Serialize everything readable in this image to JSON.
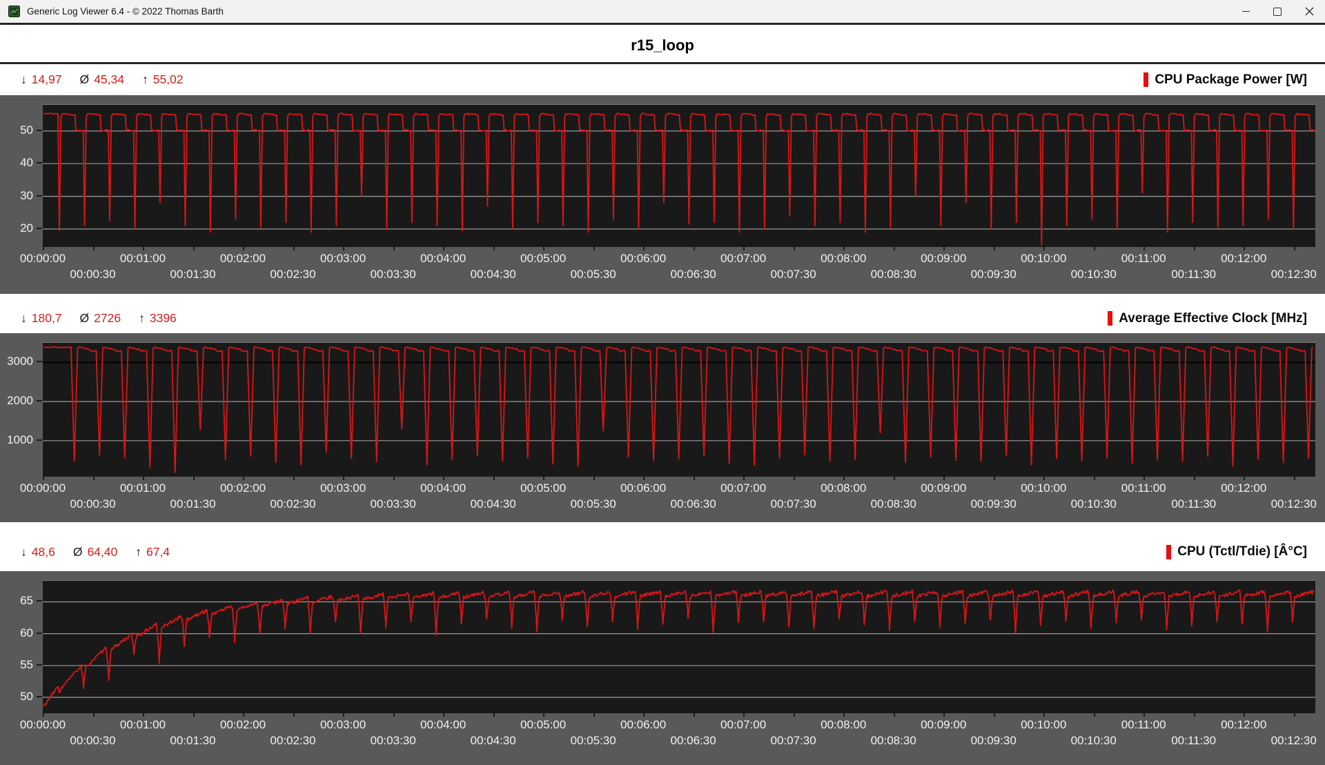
{
  "window": {
    "title": "Generic Log Viewer 6.4 - © 2022 Thomas Barth"
  },
  "header": {
    "title": "r15_loop"
  },
  "charts": [
    {
      "label": "CPU Package Power [W]",
      "accent_color": "#e60e0e",
      "stats": {
        "min_icon": "↓",
        "min": "14,97",
        "avg_icon": "Ø",
        "avg": "45,34",
        "max_icon": "↑",
        "max": "55,02"
      }
    },
    {
      "label": "Average Effective Clock [MHz]",
      "accent_color": "#e60e0e",
      "stats": {
        "min_icon": "↓",
        "min": "180,7",
        "avg_icon": "Ø",
        "avg": "2726",
        "max_icon": "↑",
        "max": "3396"
      }
    },
    {
      "label": "CPU (Tctl/Tdie) [Â°C]",
      "accent_color": "#e60e0e",
      "stats": {
        "min_icon": "↓",
        "min": "48,6",
        "avg_icon": "Ø",
        "avg": "64,40",
        "max_icon": "↑",
        "max": "67,4"
      }
    }
  ],
  "chart_data": [
    {
      "type": "line",
      "title": "CPU Package Power [W]",
      "series_color": "#db1616",
      "grid": true,
      "legend_position": "top-right",
      "stats": {
        "min": 14.97,
        "avg": 45.34,
        "max": 55.02
      },
      "y_axis": {
        "range": [
          14.5,
          58
        ],
        "ticks": [
          20,
          30,
          40,
          50
        ],
        "dark_gridlines": []
      },
      "x_axis": {
        "unit": "time",
        "duration_seconds": 762,
        "tick_labels_row1": [
          "00:00:00",
          "00:01:00",
          "00:02:00",
          "00:03:00",
          "00:04:00",
          "00:05:00",
          "00:06:00",
          "00:07:00",
          "00:08:00",
          "00:09:00",
          "00:10:00",
          "00:11:00",
          "00:12:00"
        ],
        "tick_seconds_row1": [
          0,
          60,
          120,
          180,
          240,
          300,
          360,
          420,
          480,
          540,
          600,
          660,
          720
        ],
        "tick_labels_row2": [
          "00:00:30",
          "00:01:30",
          "00:02:30",
          "00:03:30",
          "00:04:30",
          "00:05:30",
          "00:06:30",
          "00:07:30",
          "00:08:30",
          "00:09:30",
          "00:10:30",
          "00:11:30",
          "00:12:30"
        ],
        "tick_seconds_row2": [
          30,
          90,
          150,
          210,
          270,
          330,
          390,
          450,
          510,
          570,
          630,
          690,
          750
        ]
      },
      "waveform": {
        "kind": "loop-plateau",
        "seed": 11,
        "period": 15.1,
        "first_dip": 9.5,
        "high": 55.3,
        "high_end": 54.9,
        "low": 50.2,
        "high_fraction": 0.62,
        "attack": 0.8,
        "release": 1.0,
        "noise": 0.22,
        "dip_minima": [
          19.5,
          21,
          22.5,
          20,
          28,
          21,
          19,
          23,
          20.5,
          22,
          19,
          21,
          30,
          20,
          22,
          21,
          19.5,
          27,
          20,
          22,
          21,
          19,
          23,
          20,
          28,
          21.5,
          22,
          19,
          20,
          24,
          21,
          22,
          19,
          20.5,
          30,
          21,
          28,
          20,
          22,
          15,
          21,
          23,
          20,
          31,
          19,
          22,
          20.5,
          21,
          23,
          20
        ]
      }
    },
    {
      "type": "line",
      "title": "Average Effective Clock [MHz]",
      "series_color": "#db1616",
      "grid": true,
      "legend_position": "top-right",
      "stats": {
        "min": 180.7,
        "avg": 2726,
        "max": 3396
      },
      "y_axis": {
        "range": [
          80,
          3500
        ],
        "ticks": [
          1000,
          2000,
          3000
        ],
        "dark_gridlines": [
          3000
        ]
      },
      "x_axis": {
        "unit": "time",
        "duration_seconds": 762,
        "tick_labels_row1": [
          "00:00:00",
          "00:01:00",
          "00:02:00",
          "00:03:00",
          "00:04:00",
          "00:05:00",
          "00:06:00",
          "00:07:00",
          "00:08:00",
          "00:09:00",
          "00:10:00",
          "00:11:00",
          "00:12:00"
        ],
        "tick_seconds_row1": [
          0,
          60,
          120,
          180,
          240,
          300,
          360,
          420,
          480,
          540,
          600,
          660,
          720
        ],
        "tick_labels_row2": [
          "00:00:30",
          "00:01:30",
          "00:02:30",
          "00:03:30",
          "00:04:30",
          "00:05:30",
          "00:06:30",
          "00:07:30",
          "00:08:30",
          "00:09:30",
          "00:10:30",
          "00:11:30",
          "00:12:30"
        ],
        "tick_seconds_row2": [
          30,
          90,
          150,
          210,
          270,
          330,
          390,
          450,
          510,
          570,
          630,
          690,
          750
        ]
      },
      "waveform": {
        "kind": "loop-plateau",
        "seed": 22,
        "period": 15.1,
        "first_dip": 18.5,
        "high": 3390,
        "high_end": 3330,
        "low": 3295,
        "high_fraction": 0.6,
        "attack": 2.0,
        "release": 2.0,
        "noise": 14,
        "dip_minima": [
          480,
          640,
          560,
          320,
          190,
          1280,
          520,
          600,
          440,
          380,
          700,
          540,
          460,
          1300,
          380,
          520,
          620,
          480,
          560,
          400,
          350,
          1250,
          580,
          490,
          530,
          610,
          420,
          370,
          560,
          640,
          480,
          520,
          1200,
          440,
          580,
          500,
          460,
          620,
          380,
          540,
          490,
          560,
          430,
          510,
          470,
          600,
          350,
          520,
          440,
          560
        ]
      }
    },
    {
      "type": "line",
      "title": "CPU (Tctl/Tdie) [Â°C]",
      "series_color": "#db1616",
      "grid": true,
      "legend_position": "top-right",
      "stats": {
        "min": 48.6,
        "avg": 64.4,
        "max": 67.4
      },
      "y_axis": {
        "range": [
          47.5,
          68.3
        ],
        "ticks": [
          50,
          55,
          60,
          65
        ],
        "dark_gridlines": []
      },
      "x_axis": {
        "unit": "time",
        "duration_seconds": 762,
        "tick_labels_row1": [
          "00:00:00",
          "00:01:00",
          "00:02:00",
          "00:03:00",
          "00:04:00",
          "00:05:00",
          "00:06:00",
          "00:07:00",
          "00:08:00",
          "00:09:00",
          "00:10:00",
          "00:11:00",
          "00:12:00"
        ],
        "tick_seconds_row1": [
          0,
          60,
          120,
          180,
          240,
          300,
          360,
          420,
          480,
          540,
          600,
          660,
          720
        ],
        "tick_labels_row2": [
          "00:00:30",
          "00:01:30",
          "00:02:30",
          "00:03:30",
          "00:04:30",
          "00:05:30",
          "00:06:30",
          "00:07:30",
          "00:08:30",
          "00:09:30",
          "00:10:30",
          "00:11:30",
          "00:12:30"
        ],
        "tick_seconds_row2": [
          30,
          90,
          150,
          210,
          270,
          330,
          390,
          450,
          510,
          570,
          630,
          690,
          750
        ]
      },
      "waveform": {
        "kind": "ramp-saw",
        "seed": 33,
        "start": 48.6,
        "asymptote": 66.25,
        "tau": 55,
        "floor": 48.5,
        "period": 15.1,
        "first_dip": 24,
        "dip_width": 1.4,
        "saw": 0.9,
        "noise": 0.28,
        "dip_depths": [
          3.0,
          4.5,
          2.5,
          5.5,
          4.0,
          3.5,
          5.0,
          4.2,
          3.8,
          4.8,
          3.2,
          5.2,
          4.4,
          3.6,
          5.8,
          4.1,
          3.3,
          4.9,
          5.4,
          3.7,
          4.6,
          3.9,
          5.1,
          4.3,
          3.4,
          5.6,
          4.0,
          3.8,
          4.7,
          5.0,
          3.5,
          4.4,
          5.3,
          3.9,
          4.8,
          4.2,
          3.6,
          5.7,
          4.5,
          3.8,
          5.0,
          4.1,
          3.7,
          5.2,
          4.6,
          3.9,
          4.3,
          5.5,
          4.0,
          4.4
        ]
      }
    }
  ]
}
